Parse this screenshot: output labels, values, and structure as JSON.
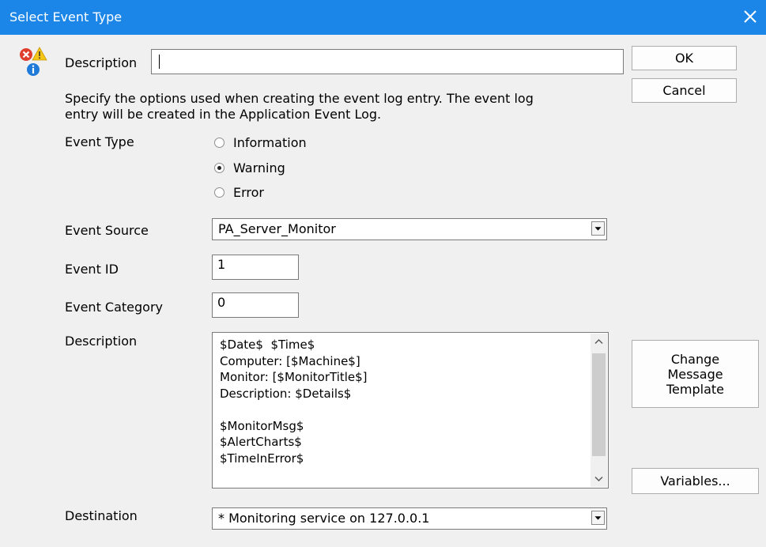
{
  "window": {
    "title": "Select Event Type"
  },
  "header": {
    "description_label": "Description",
    "description_value": ""
  },
  "buttons": {
    "ok": "OK",
    "cancel": "Cancel",
    "change_template": [
      "Change",
      "Message",
      "Template"
    ],
    "variables": "Variables..."
  },
  "intro_text": [
    "Specify the options used when creating the event log entry.  The event log",
    "entry will be created in the Application Event Log."
  ],
  "event_type": {
    "label": "Event Type",
    "options": [
      "Information",
      "Warning",
      "Error"
    ],
    "selected": "Warning"
  },
  "event_source": {
    "label": "Event Source",
    "value": "PA_Server_Monitor"
  },
  "event_id": {
    "label": "Event ID",
    "value": "1"
  },
  "event_category": {
    "label": "Event Category",
    "value": "0"
  },
  "description": {
    "label": "Description",
    "lines": [
      "$Date$  $Time$",
      "Computer: [$Machine$]",
      "Monitor: [$MonitorTitle$]",
      "Description: $Details$",
      "",
      "$MonitorMsg$",
      "$AlertCharts$",
      "$TimeInError$"
    ]
  },
  "destination": {
    "label": "Destination",
    "value": "* Monitoring service on 127.0.0.1"
  },
  "icons": {
    "close": "close-icon",
    "status": [
      "error-icon",
      "warning-icon",
      "info-icon"
    ],
    "dropdown": "chevron-down-icon"
  },
  "colors": {
    "titlebar": "#1c86e8",
    "dialog_bg": "#f0f0f0",
    "error_red": "#e03e2d",
    "warning_yellow": "#f5c518",
    "info_blue": "#1f7ad9"
  }
}
